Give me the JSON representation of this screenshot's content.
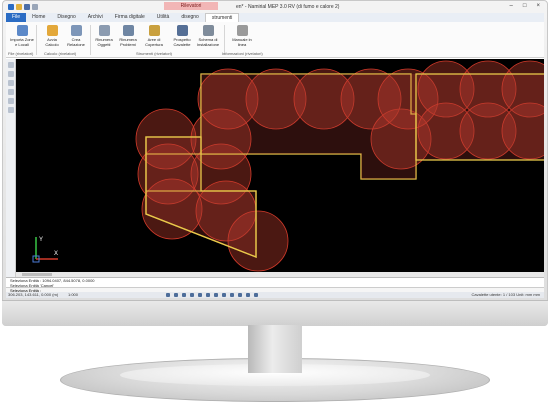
{
  "window": {
    "context_tab": "Rilevatori",
    "document_title": "en* - Namirial MEP 3.0 RV (di fumo e calore 2)",
    "minimize": "–",
    "maximize": "□",
    "close": "×"
  },
  "tabs": [
    "File",
    "Home",
    "Disegno",
    "Archivi",
    "Firma digitale",
    "Utilità",
    "disegno",
    "strumenti"
  ],
  "ribbon": {
    "buttons": [
      {
        "label": "Importa Zone e Locali",
        "icon": "import-icon"
      },
      {
        "label": "Avvia Calcolo",
        "icon": "calculate-icon"
      },
      {
        "label": "Crea Relazione",
        "icon": "report-icon"
      },
      {
        "label": "Rinumera Oggetti",
        "icon": "renumber-objects-icon"
      },
      {
        "label": "Rinumera Problemi",
        "icon": "renumber-problems-icon"
      },
      {
        "label": "Aree di Copertura",
        "icon": "coverage-areas-icon"
      },
      {
        "label": "Prospetto Cavalette",
        "icon": "table-icon"
      },
      {
        "label": "Schema di Installazione",
        "icon": "schema-icon"
      },
      {
        "label": "Manuale in linea",
        "icon": "help-icon"
      }
    ],
    "groups": [
      "File (rivelatori)",
      "Calcolo (rivelatori)",
      "Strumenti (rivelatori)",
      "Informazioni (rivelatori)"
    ]
  },
  "command": {
    "line1": "Seleziona Entità : 1094.0407, 844.5078, 0.0000",
    "line2": "Seleziona Entità 'Cancel'",
    "prompt": "Seleziona Entità :"
  },
  "status": {
    "coords": "306.203, 143.611, 0.000 (m)",
    "scale": "1:000",
    "right": "Cavalette utente: 1 / 103     Unit: mm  mm"
  },
  "colors": {
    "canvas": "#000000",
    "coverage_fill": "#b23a2c",
    "coverage_stroke": "#d23a2a",
    "outline": "#e8c84a",
    "accent": "#2b6cc4"
  }
}
